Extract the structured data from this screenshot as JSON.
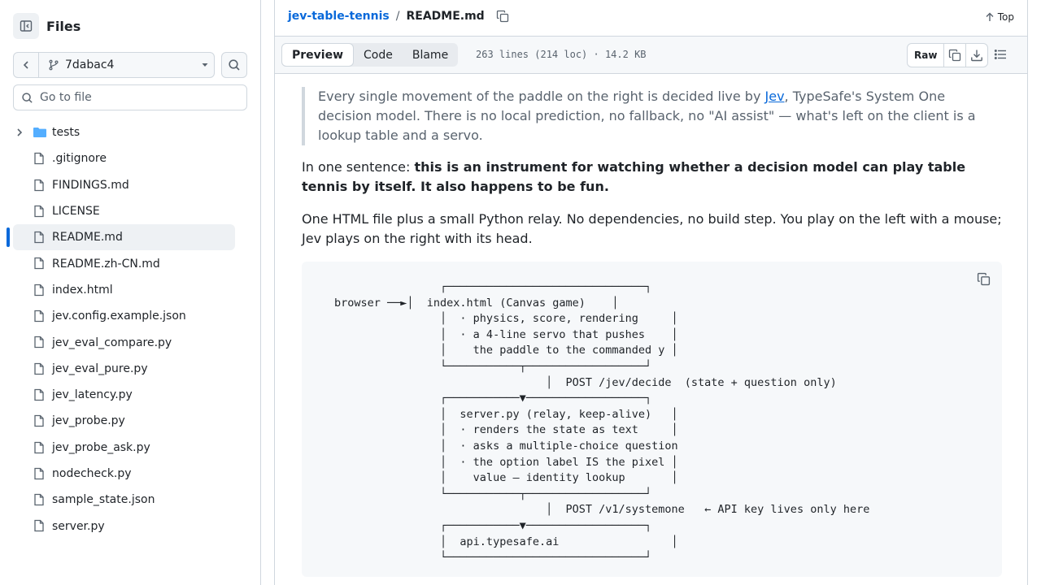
{
  "sidebar": {
    "title": "Files",
    "branch": "7dabac4",
    "goto_placeholder": "Go to file",
    "items": [
      {
        "label": "tests",
        "type": "folder"
      },
      {
        "label": ".gitignore",
        "type": "file"
      },
      {
        "label": "FINDINGS.md",
        "type": "file"
      },
      {
        "label": "LICENSE",
        "type": "file"
      },
      {
        "label": "README.md",
        "type": "file",
        "active": true
      },
      {
        "label": "README.zh-CN.md",
        "type": "file"
      },
      {
        "label": "index.html",
        "type": "file"
      },
      {
        "label": "jev.config.example.json",
        "type": "file"
      },
      {
        "label": "jev_eval_compare.py",
        "type": "file"
      },
      {
        "label": "jev_eval_pure.py",
        "type": "file"
      },
      {
        "label": "jev_latency.py",
        "type": "file"
      },
      {
        "label": "jev_probe.py",
        "type": "file"
      },
      {
        "label": "jev_probe_ask.py",
        "type": "file"
      },
      {
        "label": "nodecheck.py",
        "type": "file"
      },
      {
        "label": "sample_state.json",
        "type": "file"
      },
      {
        "label": "server.py",
        "type": "file"
      }
    ]
  },
  "header": {
    "repo": "jev-table-tennis",
    "separator": "/",
    "file": "README.md",
    "top_label": "Top"
  },
  "toolbar": {
    "tabs": [
      "Preview",
      "Code",
      "Blame"
    ],
    "active_tab": "Preview",
    "meta": "263 lines (214 loc) · 14.2 KB",
    "raw_label": "Raw"
  },
  "readme": {
    "quote_before": "Every single movement of the paddle on the right is decided live by ",
    "quote_link": "Jev",
    "quote_after": ", TypeSafe's System One decision model. There is no local prediction, no fallback, no \"AI assist\" — what's left on the client is a lookup table and a servo.",
    "p1_prefix": "In one sentence: ",
    "p1_bold": "this is an instrument for watching whether a decision model can play table tennis by itself. It also happens to be fun.",
    "p2": "One HTML file plus a small Python relay. No dependencies, no build step. You play on the left with a mouse; Jev plays on the right with its head.",
    "code": "                ┌──────────────────────────────┐\nbrowser ──►│  index.html (Canvas game)    │\n                │  · physics, score, rendering     │\n                │  · a 4-line servo that pushes    │\n                │    the paddle to the commanded y │\n                └───────────┬──────────────────┘\n                                │  POST /jev/decide  (state + question only)\n                ┌───────────▼──────────────────┐\n                │  server.py (relay, keep-alive)   │\n                │  · renders the state as text     │\n                │  · asks a multiple-choice question\n                │  · the option label IS the pixel │\n                │    value — identity lookup       │\n                └───────────┬──────────────────┘\n                                │  POST /v1/systemone   ← API key lives only here\n                ┌───────────▼──────────────────┐\n                │  api.typesafe.ai                 │\n                └──────────────────────────────┘"
  }
}
